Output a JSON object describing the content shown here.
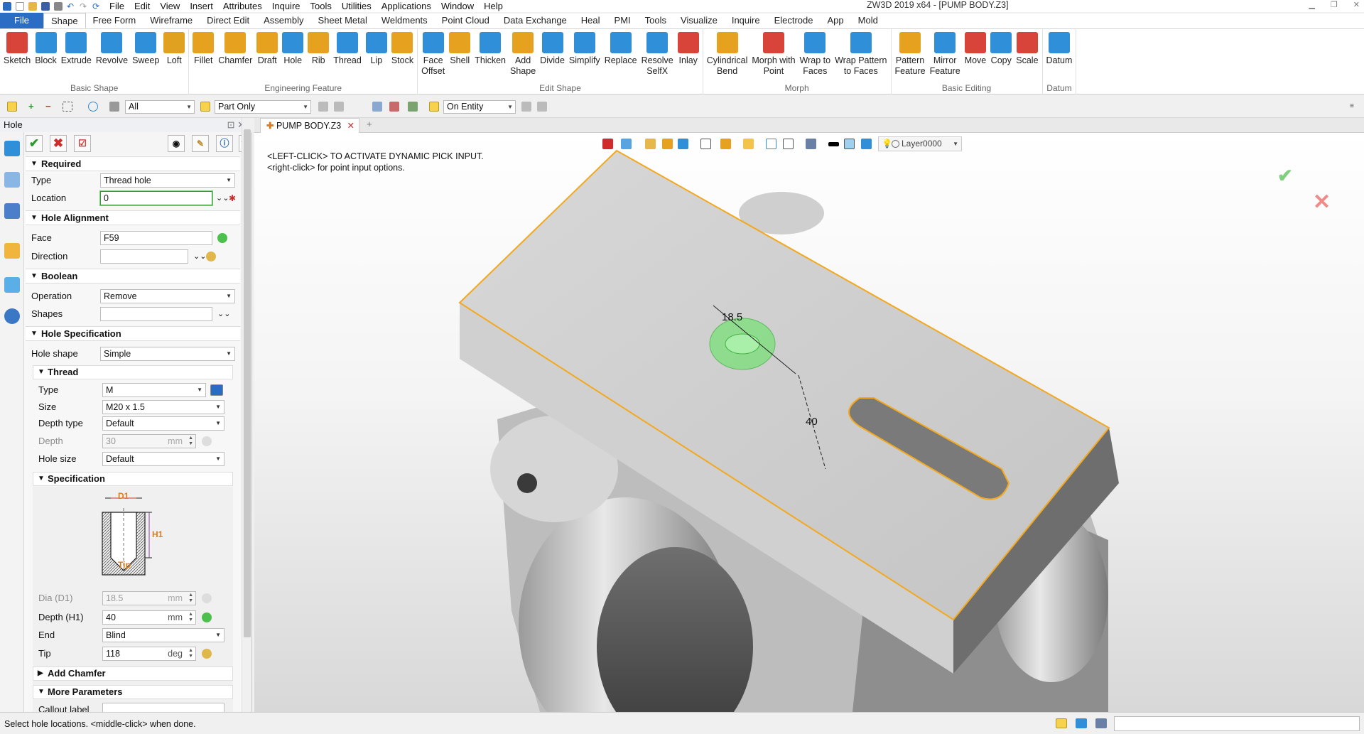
{
  "window": {
    "title": "ZW3D 2019  x64 - [PUMP BODY.Z3]"
  },
  "menubar": [
    "File",
    "Edit",
    "View",
    "Insert",
    "Attributes",
    "Inquire",
    "Tools",
    "Utilities",
    "Applications",
    "Window",
    "Help"
  ],
  "ribbon_tabs": [
    "File",
    "Shape",
    "Free Form",
    "Wireframe",
    "Direct Edit",
    "Assembly",
    "Sheet Metal",
    "Weldments",
    "Point Cloud",
    "Data Exchange",
    "Heal",
    "PMI",
    "Tools",
    "Visualize",
    "Inquire",
    "Electrode",
    "App",
    "Mold"
  ],
  "ribbon_groups": [
    {
      "label": "Basic Shape",
      "buttons": [
        {
          "label": "Sketch",
          "icon": "sketch-icon",
          "color": "#d9443a"
        },
        {
          "label": "Block",
          "icon": "block-icon",
          "color": "#2f8fd8"
        },
        {
          "label": "Extrude",
          "icon": "extrude-icon",
          "color": "#2f8fd8"
        },
        {
          "label": "Revolve",
          "icon": "revolve-icon",
          "color": "#2f8fd8"
        },
        {
          "label": "Sweep",
          "icon": "sweep-icon",
          "color": "#2f8fd8"
        },
        {
          "label": "Loft",
          "icon": "loft-icon",
          "color": "#e0a020"
        }
      ]
    },
    {
      "label": "Engineering Feature",
      "buttons": [
        {
          "label": "Fillet",
          "icon": "fillet-icon",
          "color": "#e6a21e"
        },
        {
          "label": "Chamfer",
          "icon": "chamfer-icon",
          "color": "#e6a21e"
        },
        {
          "label": "Draft",
          "icon": "draft-icon",
          "color": "#e6a21e"
        },
        {
          "label": "Hole",
          "icon": "hole-icon",
          "color": "#2f8fd8"
        },
        {
          "label": "Rib",
          "icon": "rib-icon",
          "color": "#e6a21e"
        },
        {
          "label": "Thread",
          "icon": "thread-icon",
          "color": "#2f8fd8"
        },
        {
          "label": "Lip",
          "icon": "lip-icon",
          "color": "#2f8fd8"
        },
        {
          "label": "Stock",
          "icon": "stock-icon",
          "color": "#e6a21e"
        }
      ]
    },
    {
      "label": "Edit Shape",
      "buttons": [
        {
          "label": "Face\nOffset",
          "icon": "face-offset-icon",
          "color": "#2f8fd8"
        },
        {
          "label": "Shell",
          "icon": "shell-icon",
          "color": "#e6a21e"
        },
        {
          "label": "Thicken",
          "icon": "thicken-icon",
          "color": "#2f8fd8"
        },
        {
          "label": "Add\nShape",
          "icon": "add-shape-icon",
          "color": "#e6a21e"
        },
        {
          "label": "Divide",
          "icon": "divide-icon",
          "color": "#2f8fd8"
        },
        {
          "label": "Simplify",
          "icon": "simplify-icon",
          "color": "#2f8fd8"
        },
        {
          "label": "Replace",
          "icon": "replace-icon",
          "color": "#2f8fd8"
        },
        {
          "label": "Resolve\nSelfX",
          "icon": "resolve-selfx-icon",
          "color": "#2f8fd8"
        },
        {
          "label": "Inlay",
          "icon": "inlay-icon",
          "color": "#d9443a"
        }
      ]
    },
    {
      "label": "Morph",
      "buttons": [
        {
          "label": "Cylindrical\nBend",
          "icon": "cylindrical-bend-icon",
          "color": "#e6a21e"
        },
        {
          "label": "Morph with\nPoint",
          "icon": "morph-point-icon",
          "color": "#d9443a"
        },
        {
          "label": "Wrap to\nFaces",
          "icon": "wrap-faces-icon",
          "color": "#2f8fd8"
        },
        {
          "label": "Wrap Pattern\nto Faces",
          "icon": "wrap-pattern-icon",
          "color": "#2f8fd8"
        }
      ]
    },
    {
      "label": "Basic Editing",
      "buttons": [
        {
          "label": "Pattern\nFeature",
          "icon": "pattern-feature-icon",
          "color": "#e6a21e"
        },
        {
          "label": "Mirror\nFeature",
          "icon": "mirror-feature-icon",
          "color": "#2f8fd8"
        },
        {
          "label": "Move",
          "icon": "move-icon",
          "color": "#d9443a"
        },
        {
          "label": "Copy",
          "icon": "copy-icon",
          "color": "#2f8fd8"
        },
        {
          "label": "Scale",
          "icon": "scale-icon",
          "color": "#d9443a"
        }
      ]
    },
    {
      "label": "Datum",
      "buttons": [
        {
          "label": "Datum",
          "icon": "datum-icon",
          "color": "#2f8fd8"
        }
      ]
    }
  ],
  "toolbar2": {
    "filter": "All",
    "scope": "Part Only",
    "pick": "On Entity"
  },
  "panel": {
    "title": "Hole",
    "sections": {
      "required": "Required",
      "alignment": "Hole Alignment",
      "boolean": "Boolean",
      "spec": "Hole Specification",
      "thread": "Thread",
      "specification": "Specification",
      "chamfer": "Add Chamfer",
      "more": "More Parameters"
    },
    "labels": {
      "type": "Type",
      "location": "Location",
      "face": "Face",
      "direction": "Direction",
      "operation": "Operation",
      "shapes": "Shapes",
      "hole_shape": "Hole shape",
      "thread_type": "Type",
      "size": "Size",
      "depth_type": "Depth type",
      "depth": "Depth",
      "hole_size": "Hole size",
      "dia": "Dia (D1)",
      "depth_h1": "Depth (H1)",
      "end": "End",
      "tip": "Tip",
      "callout": "Callout label"
    },
    "values": {
      "type": "Thread hole",
      "location": "0",
      "face": "F59",
      "direction": "",
      "operation": "Remove",
      "shapes": "",
      "hole_shape": "Simple",
      "thread_type": "M",
      "size": "M20 x 1.5",
      "depth_type": "Default",
      "depth": "30",
      "hole_size": "Default",
      "dia": "18.5",
      "depth_h1": "40",
      "end": "Blind",
      "tip": "118"
    },
    "units": {
      "mm": "mm",
      "deg": "deg"
    },
    "diagram": {
      "d1": "D1",
      "h1": "H1",
      "tip": "Tip"
    }
  },
  "viewport": {
    "tab": "PUMP BODY.Z3",
    "prompt_line1": "<LEFT-CLICK> TO ACTIVATE DYNAMIC PICK INPUT.",
    "prompt_line2": "<right-click> for point input options.",
    "layer": "Layer0000",
    "dim_diameter": "18.5",
    "dim_depth": "40"
  },
  "status": {
    "text": "Select hole locations. <middle-click> when done."
  }
}
